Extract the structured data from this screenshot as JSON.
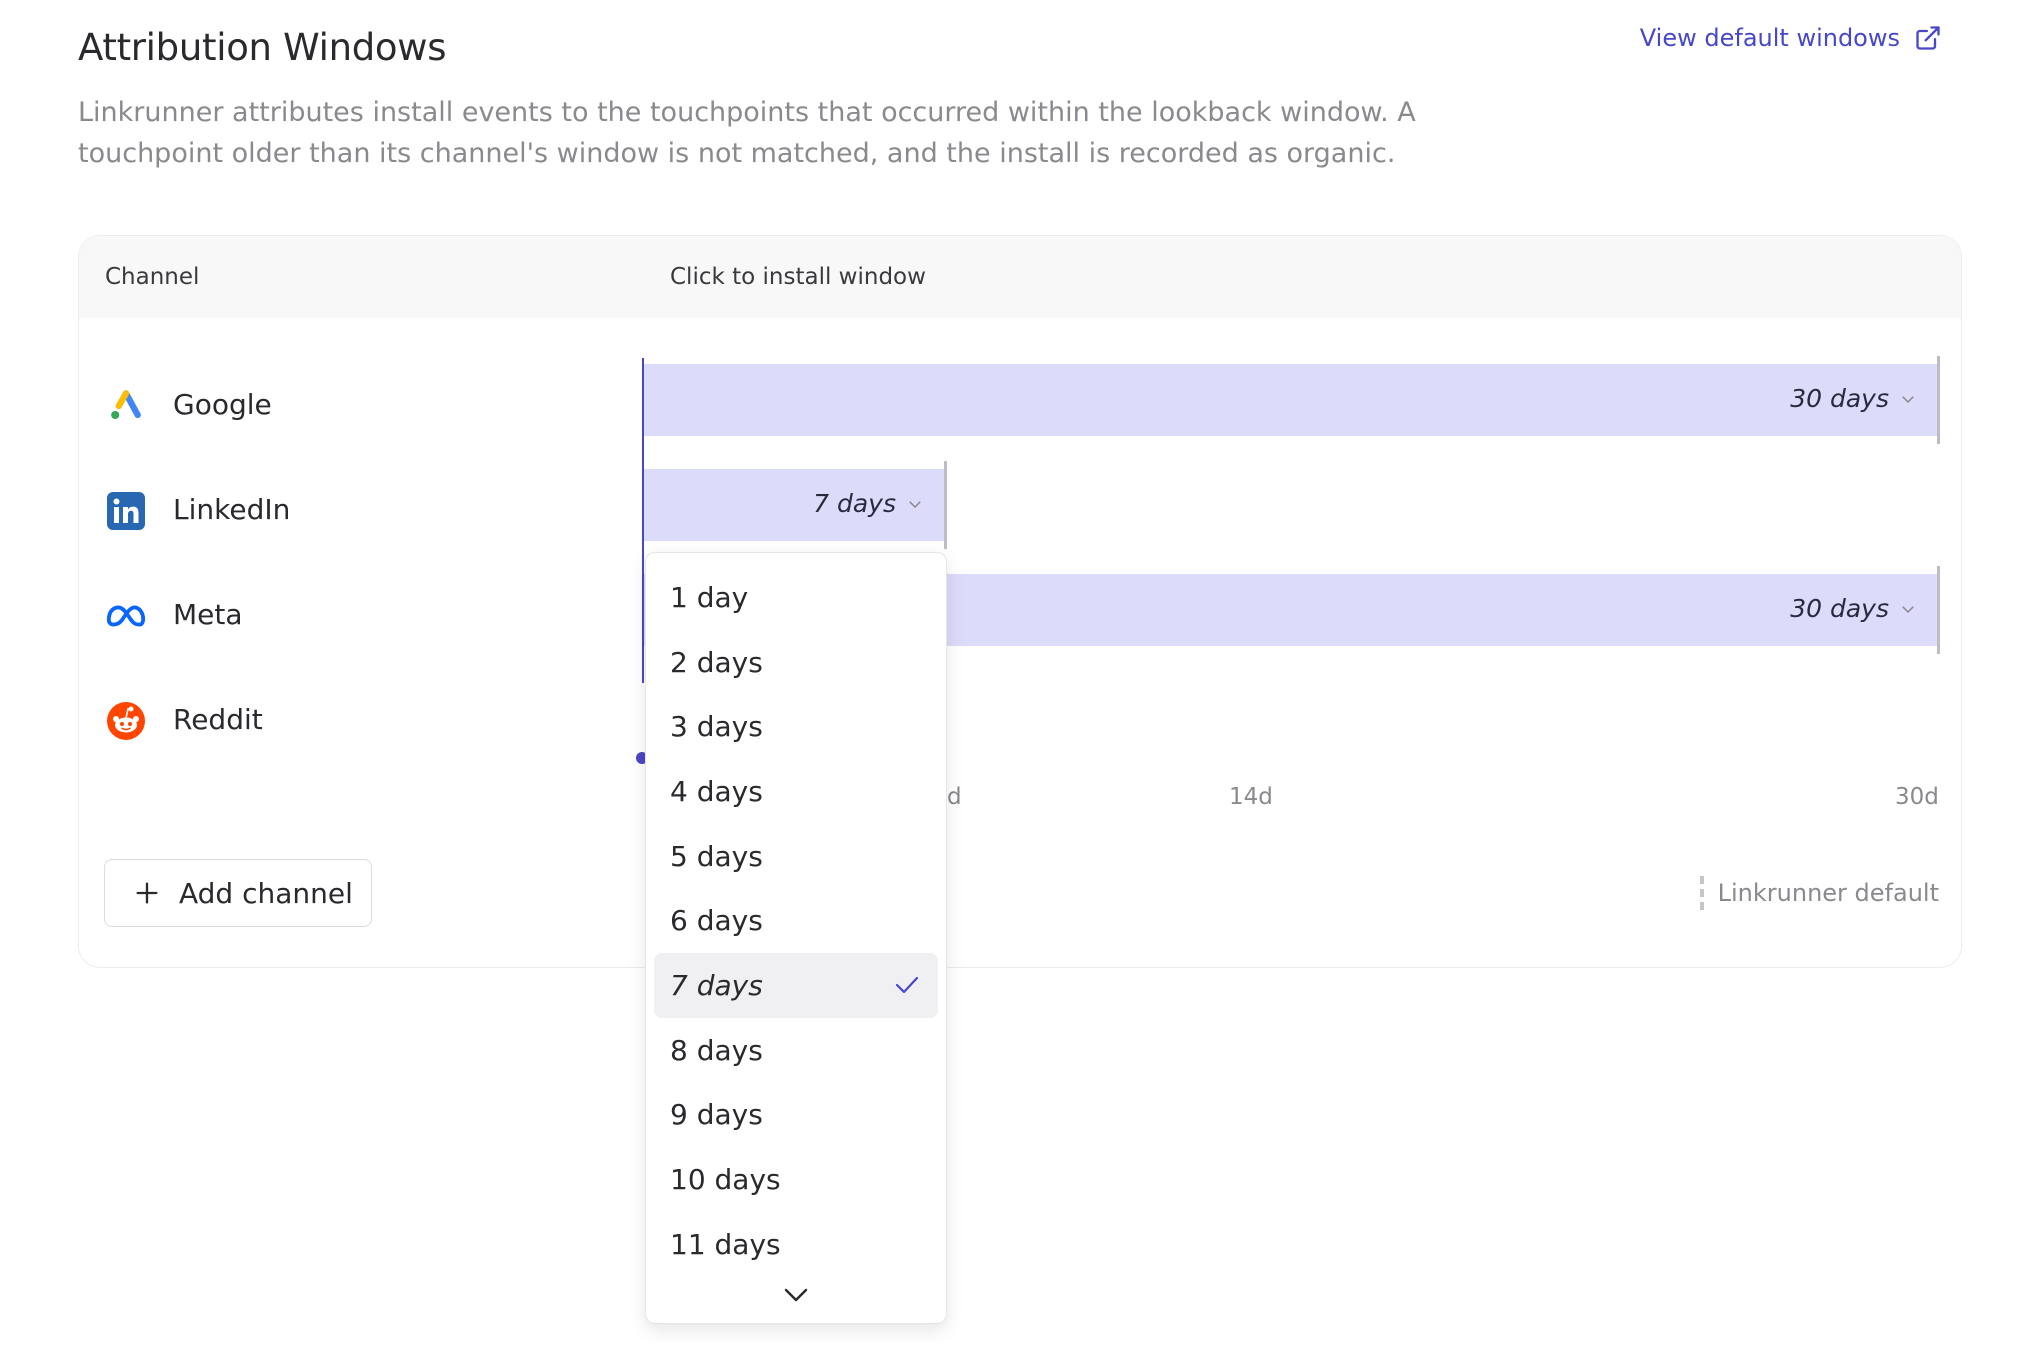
{
  "header": {
    "title": "Attribution Windows",
    "view_link": "View default windows",
    "description": "Linkrunner attributes install events to the touchpoints that occurred within the lookback window. A touchpoint older than its channel's window is not matched, and the install is recorded as organic."
  },
  "table": {
    "col_channel": "Channel",
    "col_window": "Click to install window",
    "channels": [
      {
        "label": "Google",
        "window_label": "30 days",
        "window_days": 30,
        "icon": "google-ads-icon"
      },
      {
        "label": "LinkedIn",
        "window_label": "7 days",
        "window_days": 7,
        "icon": "linkedin-icon"
      },
      {
        "label": "Meta",
        "window_label": "30 days",
        "window_days": 30,
        "icon": "meta-icon"
      },
      {
        "label": "Reddit",
        "window_label": "",
        "window_days": null,
        "icon": "reddit-icon"
      }
    ],
    "ticks": [
      "d",
      "14d",
      "30d"
    ],
    "add_button": "Add channel",
    "legend": "Linkrunner default"
  },
  "dropdown": {
    "options": [
      "1 day",
      "2 days",
      "3 days",
      "4 days",
      "5 days",
      "6 days",
      "7 days",
      "8 days",
      "9 days",
      "10 days",
      "11 days"
    ],
    "selected": "7 days"
  },
  "colors": {
    "accent": "#4747c9",
    "bar_fill": "#dcdbfa",
    "google_yellow": "#fbbc04",
    "google_blue": "#4285f4",
    "google_green": "#34a853",
    "linkedin": "#2867b2",
    "meta": "#0866ff",
    "reddit": "#ff4500"
  }
}
